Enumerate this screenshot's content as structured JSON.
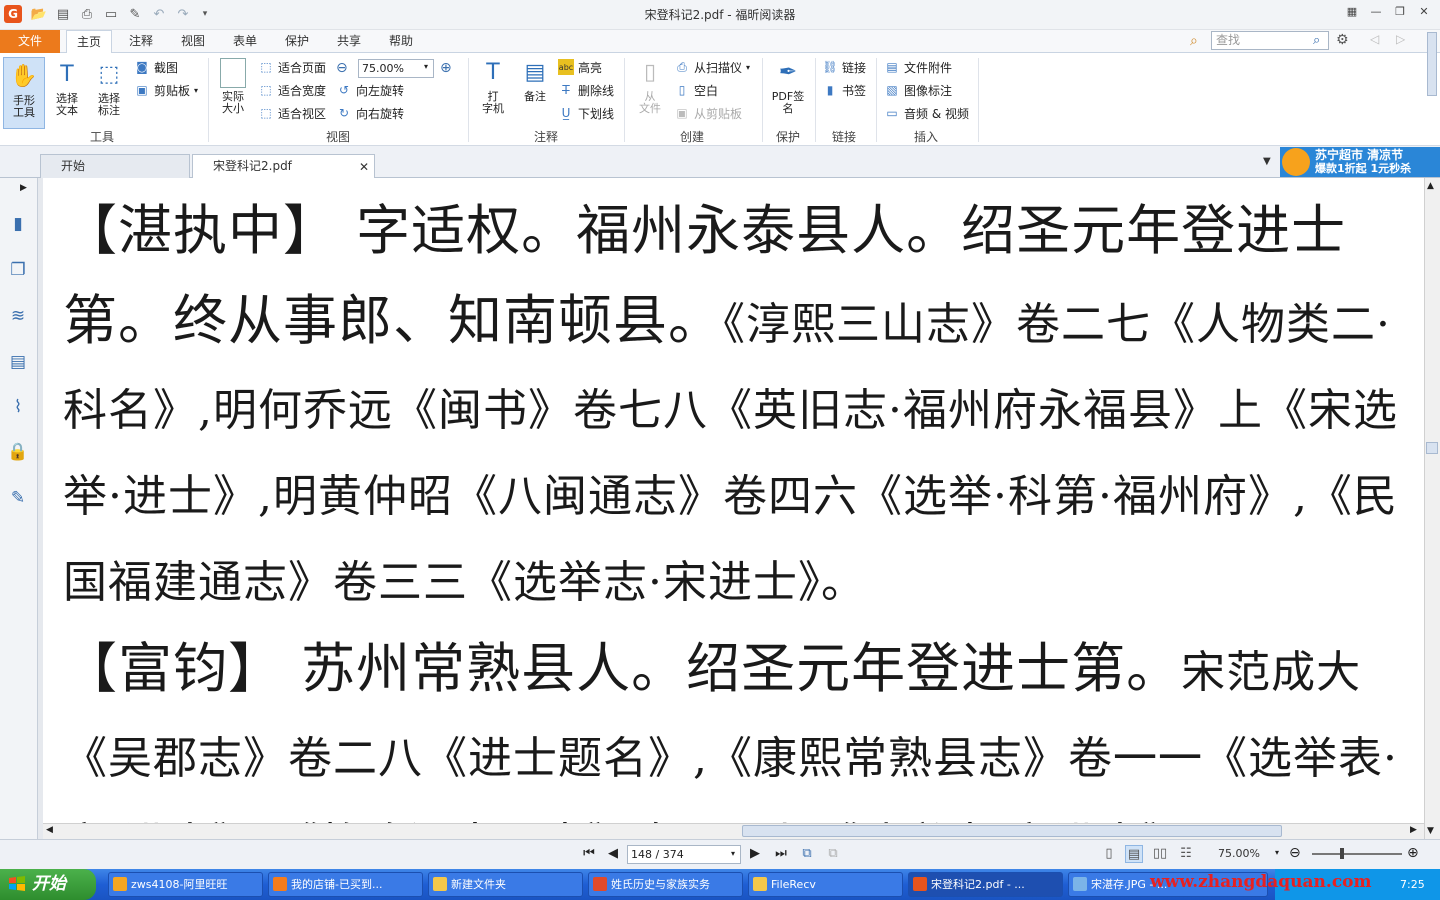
{
  "window": {
    "title": "宋登科记2.pdf - 福昕阅读器"
  },
  "menu": {
    "file": "文件",
    "tabs": [
      "主页",
      "注释",
      "视图",
      "表单",
      "保护",
      "共享",
      "帮助"
    ]
  },
  "search": {
    "placeholder": "查找"
  },
  "ribbon": {
    "tools": {
      "label": "工具",
      "hand": "手形\n工具",
      "select_text": "选择\n文本",
      "select_annot": "选择\n标注",
      "screenshot": "截图",
      "clipboard": "剪贴板"
    },
    "view": {
      "label": "视图",
      "actual_size": "实际\n大小",
      "fit_page": "适合页面",
      "fit_width": "适合宽度",
      "fit_visible": "适合视区",
      "zoom": "75.00%",
      "rotate_left": "向左旋转",
      "rotate_right": "向右旋转"
    },
    "comment": {
      "label": "注释",
      "typewriter": "打\n字机",
      "note": "备注",
      "highlight": "高亮",
      "strikeout": "删除线",
      "underline": "下划线"
    },
    "create": {
      "label": "创建",
      "from_file": "从\n文件",
      "from_scanner": "从扫描仪",
      "blank": "空白",
      "from_clipboard": "从剪贴板"
    },
    "protect": {
      "label": "保护",
      "pdf_sign": "PDF签\n名"
    },
    "links": {
      "label": "链接",
      "link": "链接",
      "bookmark": "书签"
    },
    "insert": {
      "label": "插入",
      "file_attachment": "文件附件",
      "image_annotation": "图像标注",
      "audio_video": "音频 & 视频"
    }
  },
  "doc_tabs": {
    "start": "开始",
    "current": "宋登科记2.pdf"
  },
  "ad": {
    "line1": "苏宁超市 清凉节",
    "line2": "爆款1折起 1元秒杀"
  },
  "document": {
    "paragraphs": [
      {
        "head": "【湛执中】",
        "body": " 字适权。福州永泰县人。绍圣元年登进士第。终从事郎、知南顿县。",
        "refs": "《淳熙三山志》卷二七《人物类二·科名》,明何乔远《闽书》卷七八《英旧志·福州府永福县》上《宋选举·进士》,明黄仲昭《八闽通志》卷四六《选举·科第·福州府》,《民国福建通志》卷三三《选举志·宋进士》。"
      },
      {
        "head": "【富钧】",
        "body": " 苏州常熟县人。绍圣元年登进士第。",
        "refs": "宋范成大《吴郡志》卷二八《进士题名》,《康熙常熟县志》卷一一《选举表·宋·进士》,《乾隆江南通志》卷一一七《选举志·宋进士》"
      }
    ]
  },
  "status": {
    "page": "148 / 374",
    "zoom": "75.00%"
  },
  "taskbar": {
    "start": "开始",
    "items": [
      {
        "label": "zws4108-阿里旺旺",
        "color": "#f5a623"
      },
      {
        "label": "我的店铺-已买到...",
        "color": "#f57c1c"
      },
      {
        "label": "新建文件夹",
        "color": "#f3c74a"
      },
      {
        "label": "姓氏历史与家族实务",
        "color": "#e04a2a"
      },
      {
        "label": "FileRecv",
        "color": "#f3c74a"
      },
      {
        "label": "宋登科记2.pdf - ...",
        "color": "#e8541c"
      },
      {
        "label": "宋湛存.JPG - ...",
        "color": "#7bb4e8"
      }
    ],
    "watermark": "www.zhangdaquan.com",
    "clock": "7:25"
  }
}
